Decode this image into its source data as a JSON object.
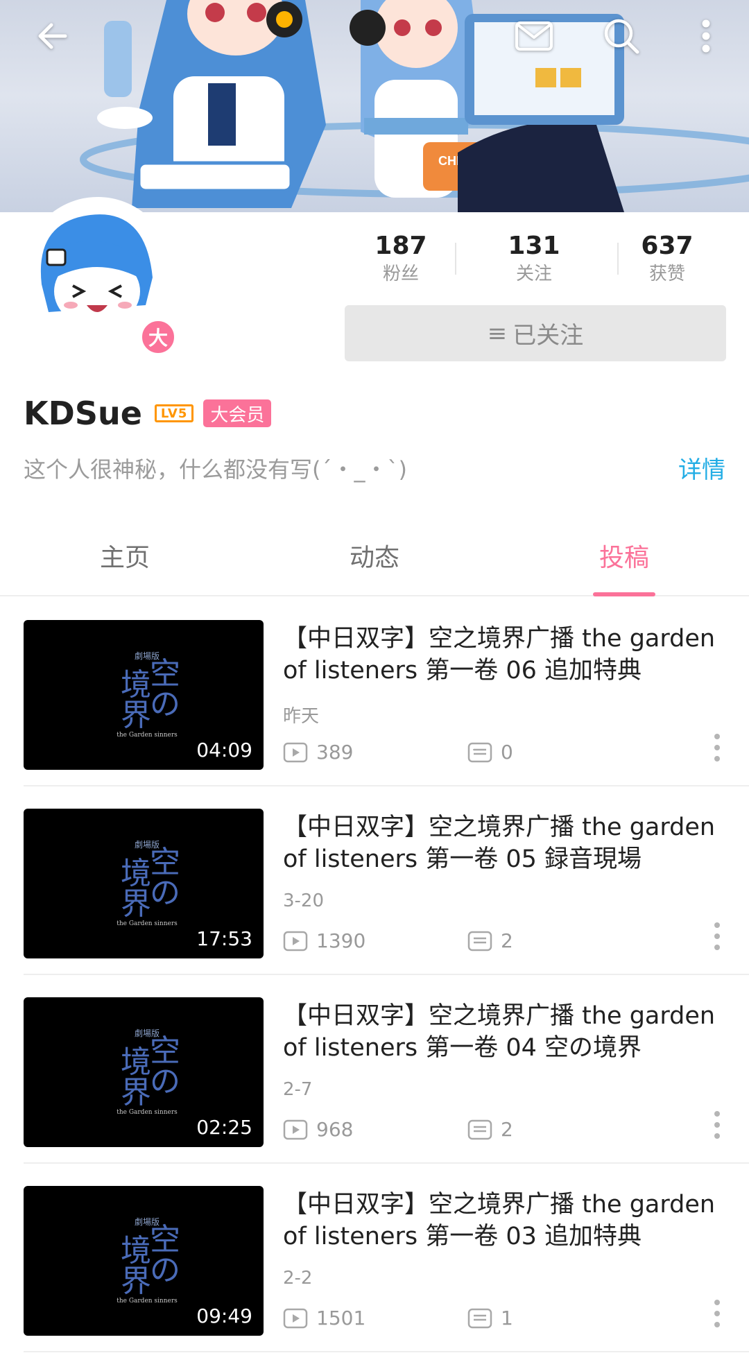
{
  "header": {
    "back_icon": "arrow-left-icon",
    "actions": [
      "mail-icon",
      "search-icon",
      "more-vertical-icon"
    ]
  },
  "profile": {
    "username": "KDSue",
    "level_badge": "LV5",
    "vip_tag": "大会员",
    "vip_badge": "大",
    "bio": "这个人很神秘，什么都没有写(´・_・`)",
    "detail_link": "详情",
    "stats": [
      {
        "value": "187",
        "label": "粉丝"
      },
      {
        "value": "131",
        "label": "关注"
      },
      {
        "value": "637",
        "label": "获赞"
      }
    ],
    "follow_button": "已关注",
    "follow_icon": "menu-lines-icon"
  },
  "tabs": [
    {
      "label": "主页",
      "active": false
    },
    {
      "label": "动态",
      "active": false
    },
    {
      "label": "投稿",
      "active": true
    }
  ],
  "videos": [
    {
      "title": "【中日双字】空之境界广播 the garden of listeners 第一卷 06 追加特典",
      "date": "昨天",
      "duration": "04:09",
      "views": "389",
      "comments": "0"
    },
    {
      "title": "【中日双字】空之境界广播 the garden of listeners 第一卷 05 録音現場",
      "date": "3-20",
      "duration": "17:53",
      "views": "1390",
      "comments": "2"
    },
    {
      "title": "【中日双字】空之境界广播 the garden of listeners 第一卷 04 空の境界",
      "date": "2-7",
      "duration": "02:25",
      "views": "968",
      "comments": "2"
    },
    {
      "title": "【中日双字】空之境界广播 the garden of listeners 第一卷 03 追加特典",
      "date": "2-2",
      "duration": "09:49",
      "views": "1501",
      "comments": "1"
    }
  ],
  "colors": {
    "accent_pink": "#fb7299",
    "link_blue": "#23ade5",
    "level_orange": "#ff9500"
  }
}
